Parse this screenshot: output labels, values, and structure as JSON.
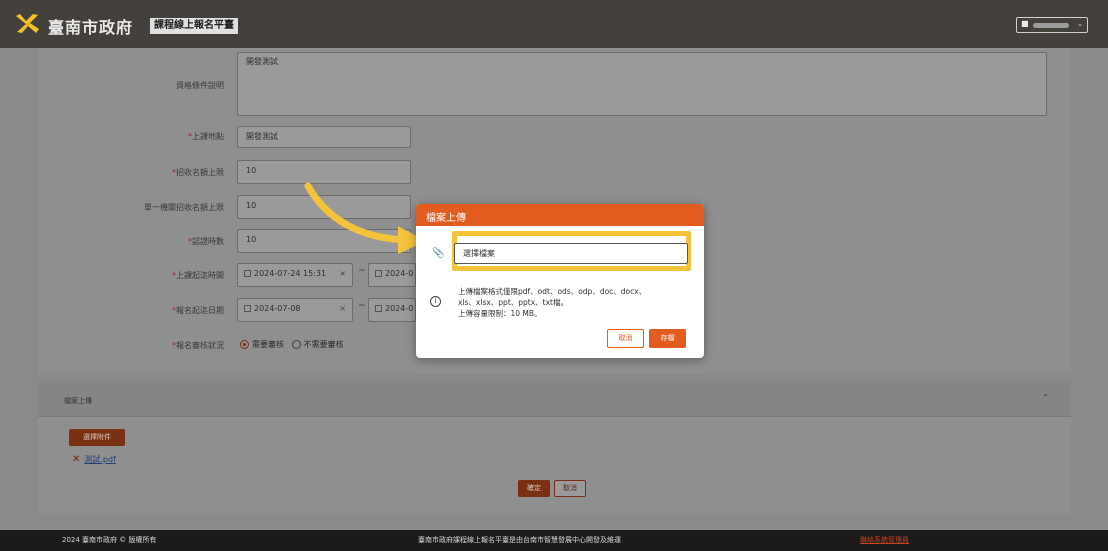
{
  "header": {
    "city_name": "臺南市政府",
    "platform_name": "課程線上報名平臺",
    "user_icon": "user-icon"
  },
  "form": {
    "qualification_label": "資格條件說明",
    "qualification_value": "開發測試",
    "location_label": "上課地點",
    "location_value": "開發測試",
    "capacity_label": "招收名額上限",
    "capacity_value": "10",
    "agency_capacity_label": "單一機關招收名額上限",
    "agency_capacity_value": "10",
    "hours_label": "認證時數",
    "hours_value": "10",
    "class_period_label": "上課起迄時間",
    "class_start": "2024-07-24 15:31",
    "class_end_partial": "2024-0",
    "signup_period_label": "報名起迄日期",
    "signup_start": "2024-07-08",
    "signup_end_partial": "2024-0",
    "review_label": "報名審核狀況",
    "review_options": [
      "需要審核",
      "不需要審核"
    ],
    "required_mark": "*",
    "range_sep": "~",
    "clear_mark": "×"
  },
  "upload_panel": {
    "title": "檔案上傳",
    "attach_button": "選擇附件",
    "file_name": "測試.pdf",
    "confirm_button": "確定",
    "cancel_button": "取消"
  },
  "modal": {
    "title": "檔案上傳",
    "file_placeholder": "選擇檔案",
    "note_line1": "上傳檔案格式僅限pdf、odt、ods、odp、doc、docx、",
    "note_line2": "xls、xlsx、ppt、pptx、txt檔。",
    "note_line3": "上傳容量限制：10 MB。",
    "cancel_button": "取消",
    "save_button": "存檔"
  },
  "footer": {
    "copyright": "2024 臺南市政府 © 版權所有",
    "credit": "臺南市政府課程線上報名平臺是由台南市智慧發展中心開發及維運",
    "contact_link": "聯絡系統管理員"
  },
  "colors": {
    "header_bg": "#44403c",
    "modal_accent": "#e25b1f",
    "highlight": "#f3c33b",
    "footer_bg": "#1b1b1b"
  }
}
